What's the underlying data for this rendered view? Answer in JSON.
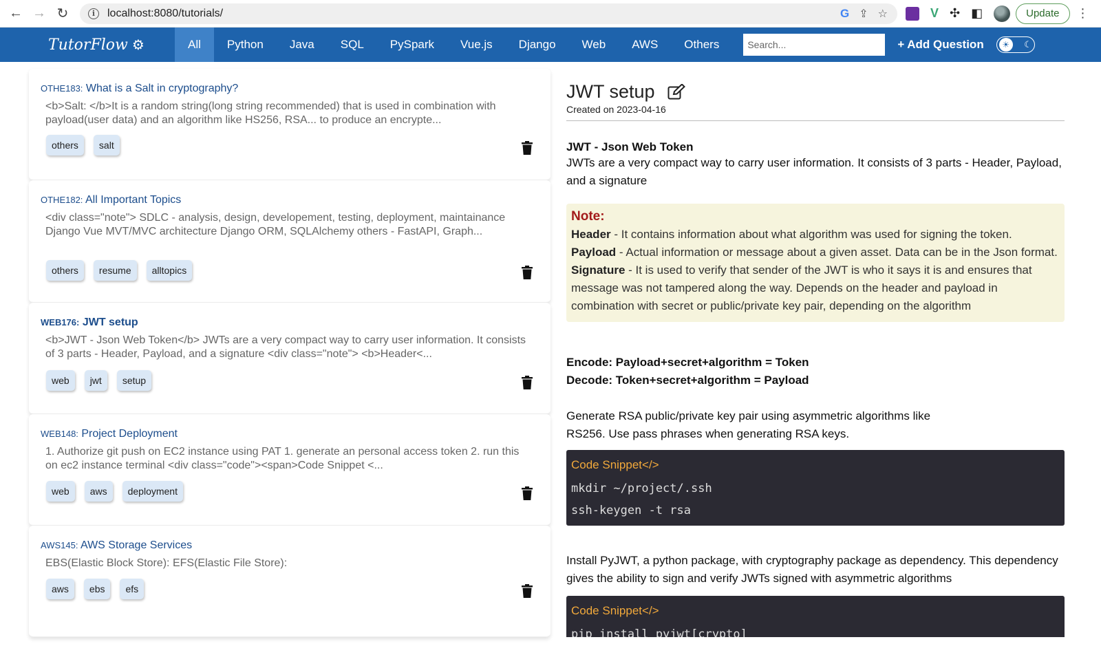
{
  "browser": {
    "url": "localhost:8080/tutorials/",
    "update_label": "Update"
  },
  "app": {
    "brand": "TutorFlow",
    "menu": [
      "All",
      "Python",
      "Java",
      "SQL",
      "PySpark",
      "Vue.js",
      "Django",
      "Web",
      "AWS",
      "Others"
    ],
    "search_placeholder": "Search...",
    "add_question": "Add Question"
  },
  "list": [
    {
      "id": "OTHE183:",
      "title": "What is a Salt in cryptography?",
      "excerpt": "<b>Salt: </b>It is a random string(long string recommended) that is used in combination with payload(user data) and an algorithm like HS256, RSA... to produce an encrypte...",
      "tags": [
        "others",
        "salt"
      ]
    },
    {
      "id": "OTHE182:",
      "title": "All Important Topics",
      "excerpt": "<div class=\"note\"> SDLC - analysis, design, developement, testing, deployment, maintainance Django Vue MVT/MVC architecture Django ORM, SQLAlchemy others - FastAPI, Graph...",
      "tags": [
        "others",
        "resume",
        "alltopics"
      ]
    },
    {
      "id": "WEB176:",
      "title": "JWT setup",
      "excerpt": "<b>JWT - Json Web Token</b> JWTs are a very compact way to carry user information. It consists of 3 parts - Header, Payload, and a signature <div class=\"note\"> <b>Header<...",
      "tags": [
        "web",
        "jwt",
        "setup"
      ]
    },
    {
      "id": "WEB148:",
      "title": "Project Deployment",
      "excerpt": "1. Authorize git push on EC2 instance using PAT 1. generate an personal access token 2. run this on ec2 instance terminal <div class=\"code\"><span>Code Snippet <...",
      "tags": [
        "web",
        "aws",
        "deployment"
      ]
    },
    {
      "id": "AWS145:",
      "title": "AWS Storage Services",
      "excerpt": "EBS(Elastic Block Store): EFS(Elastic File Store):",
      "tags": [
        "aws",
        "ebs",
        "efs"
      ]
    }
  ],
  "detail": {
    "title": "JWT setup",
    "created": "Created on 2023-04-16",
    "heading": "JWT - Json Web Token",
    "intro": "JWTs are a very compact way to carry user information. It consists of 3 parts - Header, Payload, and a signature",
    "note": {
      "title": "Note:",
      "header_label": "Header",
      "header_text": " - It contains information about what algorithm was used for signing the token.",
      "payload_label": "Payload",
      "payload_text": " - Actual information or message about a given asset. Data can be in the Json format.",
      "signature_label": "Signature",
      "signature_text": " - It is used to verify that sender of the JWT is who it says it is and ensures that message was not tampered along the way. Depends on the header and payload in combination with secret or public/private key pair, depending on the algorithm"
    },
    "encode": "Encode: Payload+secret+algorithm = Token",
    "decode": "Decode: Token+secret+algorithm = Payload",
    "rsa": "Generate RSA public/private key pair using asymmetric algorithms like RS256. Use pass phrases when generating RSA keys.",
    "code1": {
      "header": "Code Snippet</>",
      "lines": [
        "mkdir ~/project/.ssh",
        "ssh-keygen -t rsa"
      ]
    },
    "pyjwt": "Install PyJWT, a python package, with cryptography package as dependency. This dependency gives the ability to sign and verify JWTs signed with asymmetric algorithms",
    "code2": {
      "header": "Code Snippet</>",
      "lines": [
        "pip install pyjwt[crypto]"
      ]
    }
  }
}
